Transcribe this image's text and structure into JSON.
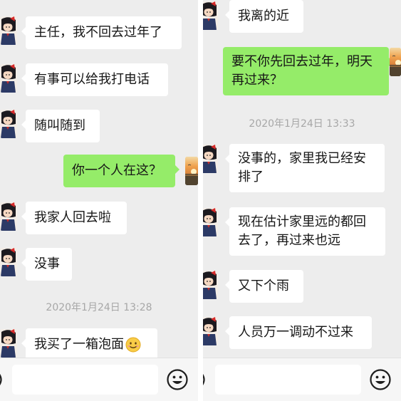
{
  "left_panel": {
    "messages": [
      {
        "text": "主任，我不回去过年了"
      },
      {
        "text": "有事可以给我打电话"
      },
      {
        "text": "随叫随到"
      },
      {
        "text": "你一个人在这？"
      },
      {
        "text": "我家人回去啦"
      },
      {
        "text": "没事"
      },
      {
        "text": "我买了一箱泡面"
      }
    ],
    "timestamp": "2020年1月24日 13:28",
    "last_message_emoji": "smiling-face-emoji"
  },
  "right_panel": {
    "messages": [
      {
        "text": "我离的近"
      },
      {
        "text": "要不你先回去过年，明天再过来？"
      },
      {
        "text": "没事的，家里我已经安排了"
      },
      {
        "text": "现在估计家里远的都回去了，再过来也远"
      },
      {
        "text": "又下个雨"
      },
      {
        "text": "人员万一调动不过来"
      }
    ],
    "timestamp": "2020年1月24日 13:33"
  },
  "colors": {
    "chat_background": "#ededed",
    "incoming_bubble": "#ffffff",
    "outgoing_bubble": "#95ec69",
    "timestamp_text": "#a7a7a7"
  },
  "icons": [
    "girl-avatar-icon",
    "sunset-avatar-icon",
    "voice-icon",
    "emoji-icon"
  ]
}
